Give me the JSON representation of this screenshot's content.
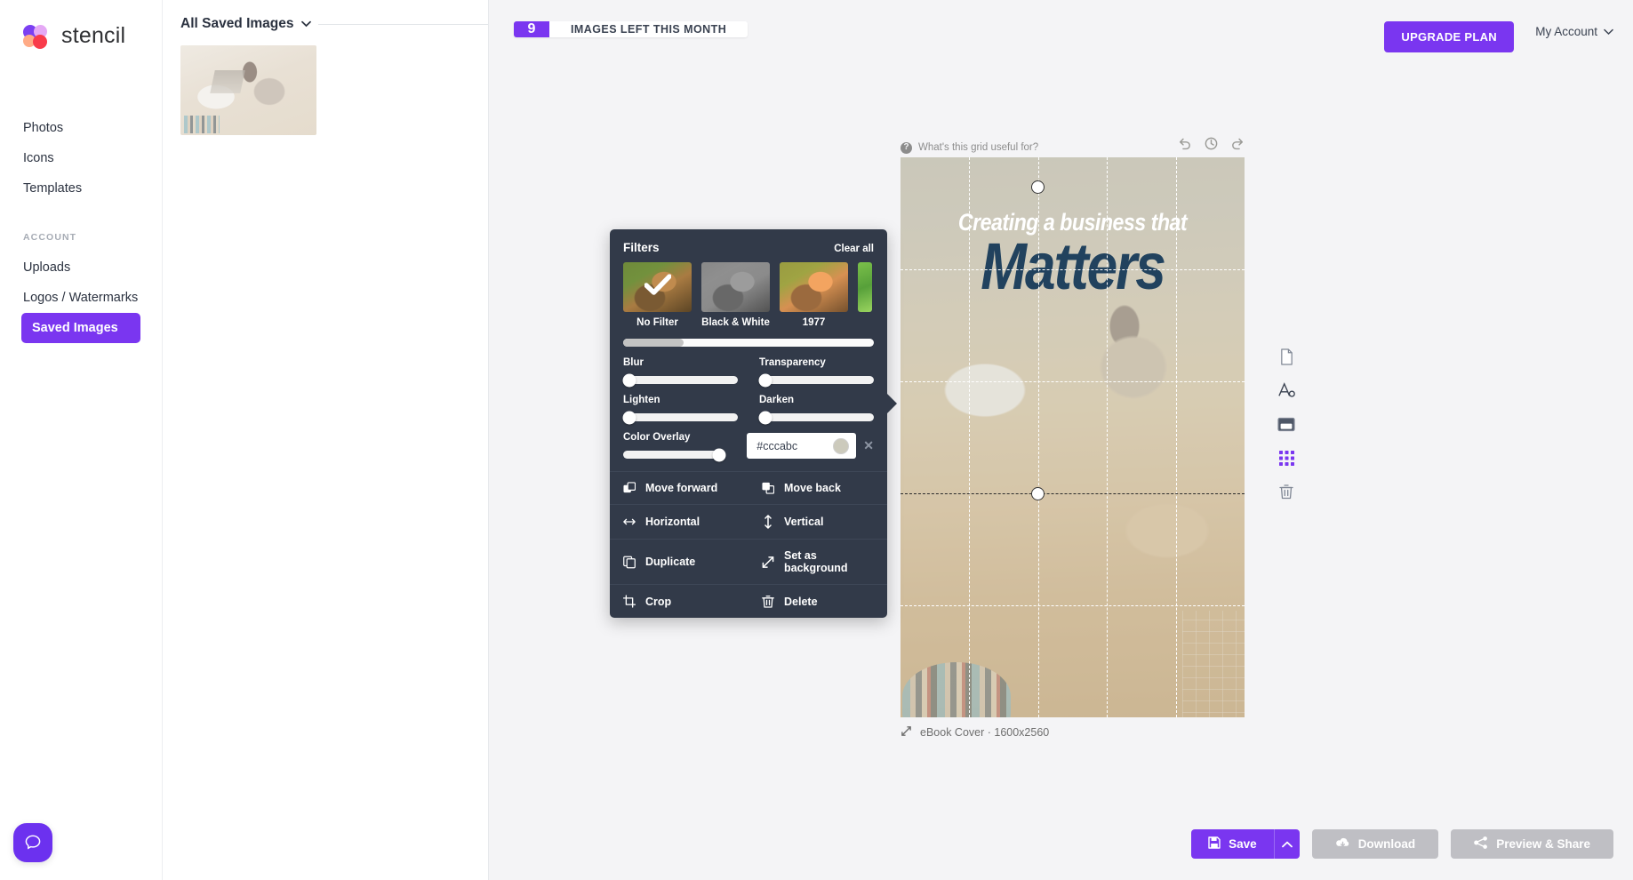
{
  "brand": {
    "name": "stencil"
  },
  "sidebar": {
    "items": [
      {
        "label": "Photos",
        "name": "photos"
      },
      {
        "label": "Icons",
        "name": "icons"
      },
      {
        "label": "Templates",
        "name": "templates"
      }
    ],
    "section_label": "ACCOUNT",
    "account_items": [
      {
        "label": "Uploads",
        "name": "uploads",
        "active": false
      },
      {
        "label": "Logos / Watermarks",
        "name": "logos-watermarks",
        "active": false
      },
      {
        "label": "Saved Images",
        "name": "saved-images",
        "active": true
      }
    ],
    "accent_color": "#7a36f0"
  },
  "images_panel": {
    "title": "All Saved Images",
    "chevron": "⌄",
    "thumbnails": [
      {
        "name": "saved-image-1"
      }
    ]
  },
  "topbar": {
    "quota_count": "9",
    "quota_label": "IMAGES LEFT THIS MONTH",
    "upgrade_label": "UPGRADE PLAN",
    "account_label": "My Account",
    "account_chevron": "⌄"
  },
  "canvas": {
    "grid_help": "What's this grid useful for?",
    "grid_help_icon": "question-mark",
    "history": [
      {
        "name": "undo-icon",
        "title": "Undo"
      },
      {
        "name": "history-clock-icon",
        "title": "History"
      },
      {
        "name": "redo-icon",
        "title": "Redo"
      }
    ],
    "headline_line1": "Creating a business that",
    "headline_line2": "Matters",
    "headline_line1_color": "#ffffff",
    "headline_line2_color": "#21425e",
    "footer_label": "eBook Cover · 1600x2560",
    "footer_icon": "resize-icon"
  },
  "tool_rail": [
    {
      "name": "page-icon",
      "title": "Canvas size"
    },
    {
      "name": "text-icon",
      "title": "Text"
    },
    {
      "name": "background-icon",
      "title": "Background"
    },
    {
      "name": "grid-icon",
      "title": "Grid"
    },
    {
      "name": "trash-icon",
      "title": "Delete"
    }
  ],
  "filters": {
    "title": "Filters",
    "clear_label": "Clear all",
    "presets": [
      {
        "label": "No Filter",
        "selected": true,
        "style": "none"
      },
      {
        "label": "Black & White",
        "selected": false,
        "style": "bw"
      },
      {
        "label": "1977",
        "selected": false,
        "style": "f1977"
      },
      {
        "label": "",
        "selected": false,
        "style": "partial"
      }
    ],
    "sliders": [
      {
        "label": "Blur",
        "value": 0
      },
      {
        "label": "Transparency",
        "value": 0
      },
      {
        "label": "Lighten",
        "value": 0
      },
      {
        "label": "Darken",
        "value": 0
      }
    ],
    "color_overlay": {
      "label": "Color Overlay",
      "slider_value": 100,
      "hex": "#cccabc",
      "placeholder": "#000000",
      "swatch_color": "#cccabc",
      "clear_glyph": "✕"
    },
    "actions": [
      [
        {
          "label": "Move forward",
          "icon": "move-forward-icon"
        },
        {
          "label": "Move back",
          "icon": "move-back-icon"
        }
      ],
      [
        {
          "label": "Horizontal",
          "icon": "flip-horizontal-icon"
        },
        {
          "label": "Vertical",
          "icon": "flip-vertical-icon"
        }
      ],
      [
        {
          "label": "Duplicate",
          "icon": "duplicate-icon"
        },
        {
          "label": "Set as background",
          "icon": "set-as-background-icon"
        }
      ],
      [
        {
          "label": "Crop",
          "icon": "crop-icon"
        },
        {
          "label": "Delete",
          "icon": "delete-icon"
        }
      ]
    ]
  },
  "bottom_actions": {
    "save_label": "Save",
    "save_icon": "floppy-icon",
    "save_caret": "⌃",
    "download_label": "Download",
    "download_icon": "cloud-download-icon",
    "preview_label": "Preview & Share",
    "preview_icon": "share-icon"
  },
  "help": {
    "icon": "chat-bubble-icon"
  }
}
